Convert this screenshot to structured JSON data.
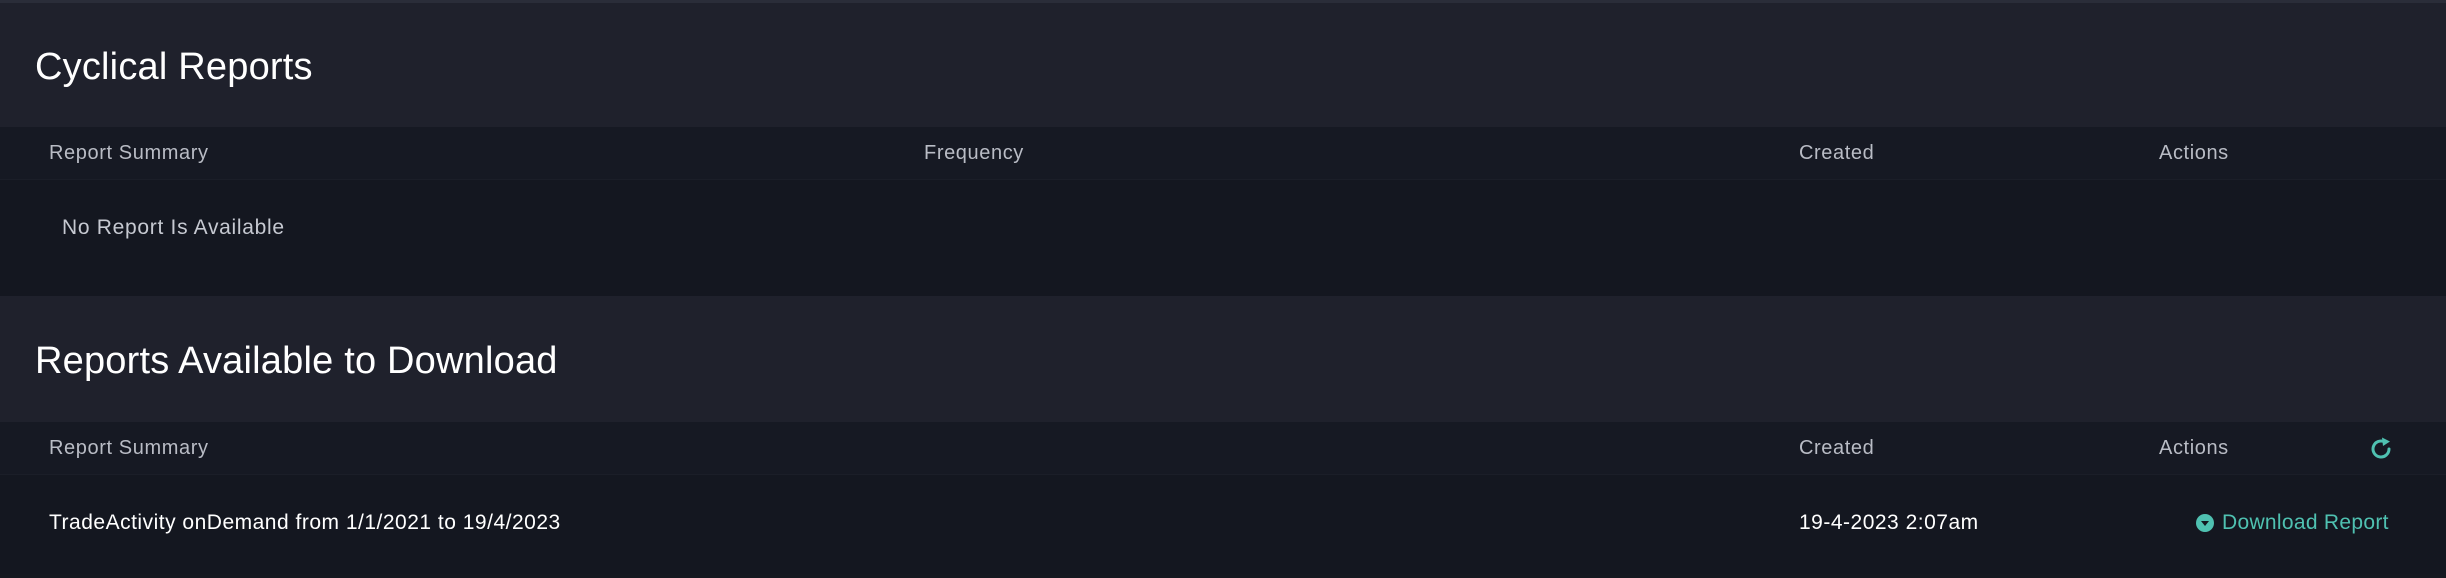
{
  "cyclical": {
    "title": "Cyclical Reports",
    "columns": {
      "summary": "Report Summary",
      "frequency": "Frequency",
      "created": "Created",
      "actions": "Actions"
    },
    "empty_message": "No Report Is Available"
  },
  "downloads": {
    "title": "Reports Available to Download",
    "columns": {
      "summary": "Report Summary",
      "created": "Created",
      "actions": "Actions"
    },
    "refresh_icon": "refresh-icon",
    "rows": [
      {
        "summary": "TradeActivity onDemand from 1/1/2021 to 19/4/2023",
        "created": "19-4-2023 2:07am",
        "action_label": "Download Report",
        "action_icon": "download-circle-icon"
      }
    ]
  },
  "colors": {
    "accent": "#4fc1b1",
    "header_bg": "#1f212c",
    "table_bg": "#141720"
  }
}
